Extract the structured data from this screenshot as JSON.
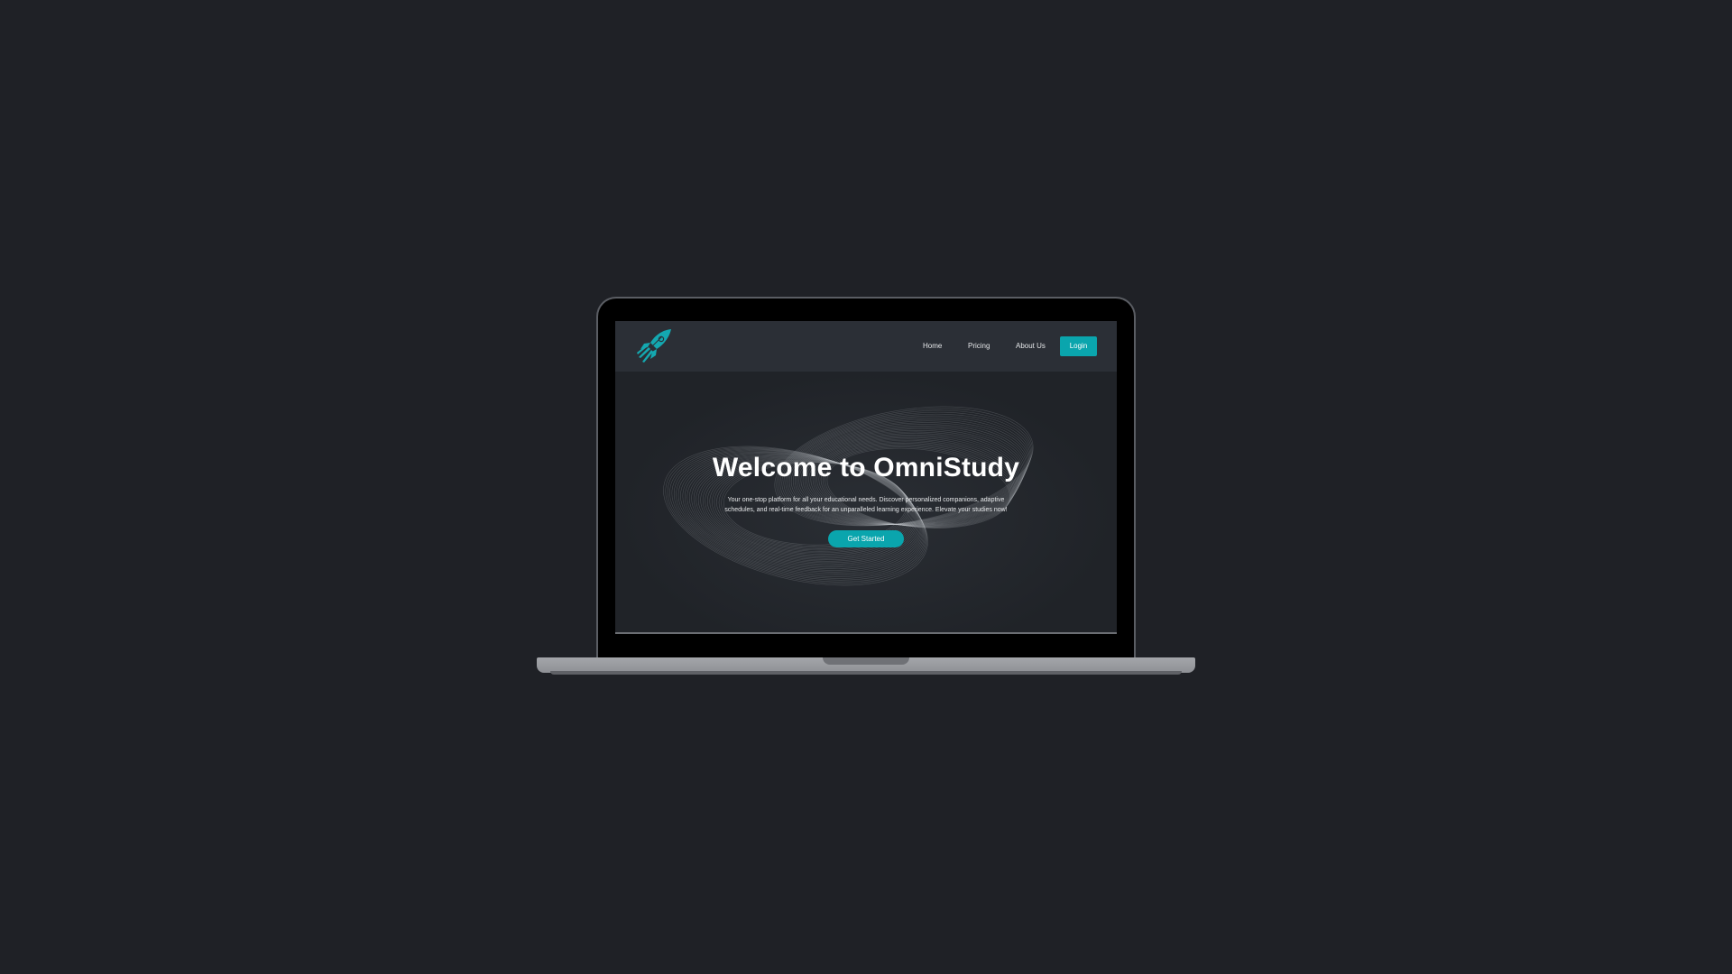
{
  "nav": {
    "logo_icon": "rocket-icon",
    "links": [
      {
        "label": "Home"
      },
      {
        "label": "Pricing"
      },
      {
        "label": "About Us"
      }
    ],
    "login_label": "Login"
  },
  "hero": {
    "title": "Welcome to OmniStudy",
    "description": "Your one-stop platform for all your educational needs. Discover personalized companions, adaptive schedules, and real-time feedback for an unparalleled learning experience. Elevate your studies now!",
    "cta_label": "Get Started"
  },
  "colors": {
    "accent": "#0aa5ad",
    "background": "#1f2126",
    "navbar": "#2b2f36",
    "hero": "#24272c"
  }
}
